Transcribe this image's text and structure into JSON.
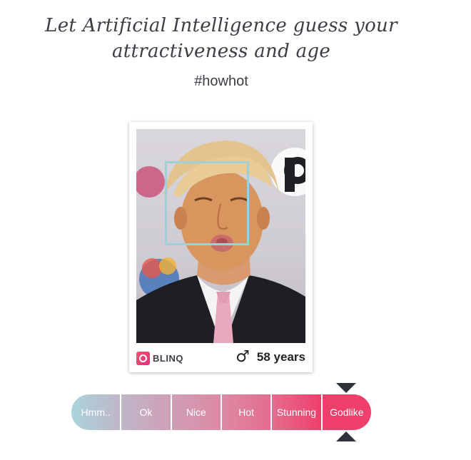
{
  "header": {
    "line1": "Let Artificial Intelligence guess your",
    "line2": "attractiveness and age",
    "hashtag": "#howhot"
  },
  "card": {
    "brand": "BLINQ",
    "brand_icon": "blinq-logo-icon",
    "gender_icon": "male-icon",
    "gender_symbol": "♂",
    "age": "58 years",
    "face_box_color": "#9fd0d8"
  },
  "scale": {
    "items": [
      "Hmm..",
      "Ok",
      "Nice",
      "Hot",
      "Stunning",
      "Godlike"
    ],
    "selected": "Godlike",
    "colors": [
      "#a9d4dc",
      "#bfb6c8",
      "#cf9fb6",
      "#dc8aa4",
      "#e36d8e",
      "#ef3f6b"
    ]
  }
}
